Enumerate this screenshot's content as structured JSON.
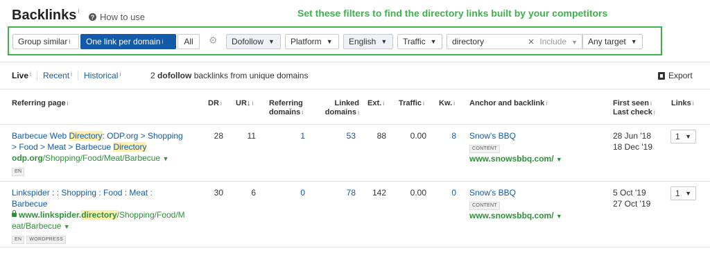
{
  "header": {
    "title": "Backlinks",
    "title_sup": "i",
    "how_to": "How to use"
  },
  "annotation": "Set these filters to find the directory links built by your competitors",
  "filters": {
    "group_similar": "Group similar",
    "one_per_domain": "One link per domain",
    "all": "All",
    "dofollow": "Dofollow",
    "platform": "Platform",
    "language": "English",
    "traffic": "Traffic",
    "search_value": "directory",
    "include": "Include",
    "target": "Any target"
  },
  "tabs": {
    "live": "Live",
    "recent": "Recent",
    "historical": "Historical"
  },
  "summary": {
    "count": "2",
    "bold": "dofollow",
    "rest": "backlinks from unique domains"
  },
  "export_label": "Export",
  "columns": {
    "referring_page": "Referring page",
    "dr": "DR",
    "ur": "UR",
    "ref_domains_1": "Referring",
    "ref_domains_2": "domains",
    "linked_1": "Linked",
    "linked_2": "domains",
    "ext": "Ext.",
    "traffic": "Traffic",
    "kw": "Kw.",
    "anchor": "Anchor and backlink",
    "first_seen": "First seen",
    "last_check": "Last check",
    "links": "Links"
  },
  "rows": [
    {
      "t1": "Barbecue Web ",
      "t2": "Directory",
      "t3": ": ODP.org > Shopping",
      "t4": "> Food > Meat > Barbecue ",
      "t5": "Directory",
      "u1": "odp.org",
      "u2": "/Shopping/Food/Meat/Barbecue",
      "badge1": "EN",
      "dr": "28",
      "ur": "11",
      "ref_domains": "1",
      "linked": "53",
      "ext": "88",
      "traffic": "0.00",
      "kw": "8",
      "anchor": "Snow's BBQ",
      "anchor_badge": "CONTENT",
      "backlink": "www.snowsbbq.com/",
      "first_seen": "28 Jun '18",
      "last_check": "18 Dec '19",
      "links": "1"
    },
    {
      "t1": "Linkspider : : Shopping : Food : Meat :",
      "t2": "Barbecue",
      "u1": "www.linkspider.",
      "u2": "directory",
      "u3": "/Shopping/Food/M",
      "u4": "eat/Barbecue",
      "badge1": "EN",
      "badge2": "WORDPRESS",
      "dr": "30",
      "ur": "6",
      "ref_domains": "0",
      "linked": "78",
      "ext": "142",
      "traffic": "0.00",
      "kw": "0",
      "anchor": "Snow's BBQ",
      "anchor_badge": "CONTENT",
      "backlink": "www.snowsbbq.com/",
      "first_seen": "5 Oct '19",
      "last_check": "27 Oct '19",
      "links": "1"
    }
  ]
}
